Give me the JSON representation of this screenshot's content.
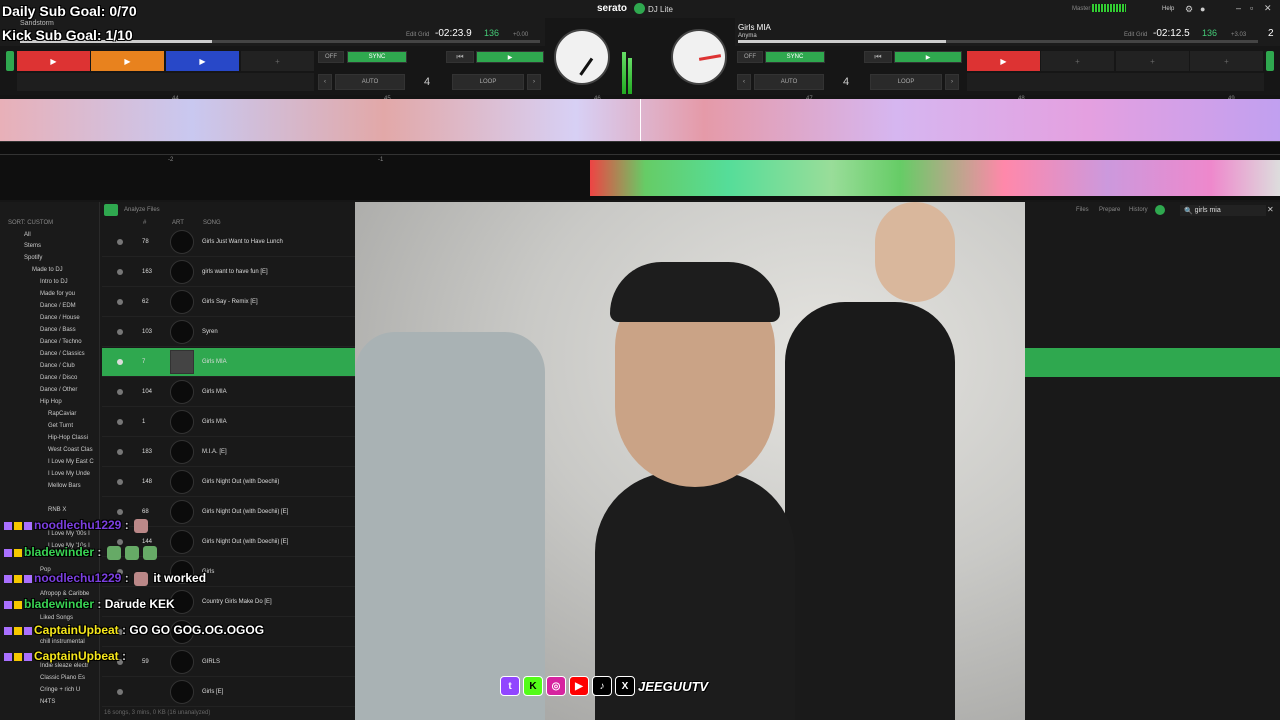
{
  "overlay": {
    "daily_goal": "Daily Sub Goal: 0/70",
    "kick_goal": "Kick Sub Goal: 1/10"
  },
  "app": {
    "title": "serato",
    "subtitle": "DJ Lite"
  },
  "topbar": {
    "master": "Master",
    "help": "Help"
  },
  "deck_left": {
    "track": "Sandstorm",
    "time": "-02:23.9",
    "bpm": "136",
    "bpm_sub": "+0.00",
    "edit_grid": "Edit Grid",
    "loop_count": "4",
    "auto": "AUTO",
    "loop": "LOOP",
    "sync": "SYNC",
    "off": "OFF"
  },
  "deck_right": {
    "track": "Girls MIA",
    "artist": "Anyma",
    "time": "-02:12.5",
    "bpm": "136",
    "bpm_sub": "+3.03",
    "edit_grid": "Edit Grid",
    "loop_count": "4",
    "auto": "AUTO",
    "loop": "LOOP",
    "sync": "SYNC",
    "off": "OFF",
    "deck_number": "2"
  },
  "beat_markers": [
    "44",
    "45",
    "46",
    "47",
    "48",
    "49"
  ],
  "overview_markers": [
    "-2",
    "-1"
  ],
  "library": {
    "sort": "SORT: CUSTOM",
    "analyze": "Analyze Files",
    "col_art": "ART",
    "col_song": "SONG",
    "col_num": "#",
    "tabs": [
      "Files",
      "Prepare",
      "History"
    ],
    "search": "girls mia",
    "sidebar": [
      "All",
      "Stems",
      "Spotify",
      "Made to DJ",
      "Intro to DJ",
      "Made for you",
      "Dance / EDM",
      "Dance / House",
      "Dance / Bass",
      "Dance / Techno",
      "Dance / Classics",
      "Dance / Club",
      "Dance / Disco",
      "Dance / Other",
      "Hip Hop",
      "RapCaviar",
      "Get Turnt",
      "Hip-Hop Classi",
      "West Coast Clas",
      "I Love My East C",
      "I Love My Unde",
      "Mellow Bars",
      "RNB X",
      "I Love My '00s I",
      "I Love My '10s I",
      "Pop",
      "Afropop & Caribbe",
      "Liked Songs",
      "chill instrumental",
      "Indie sleaze electr",
      "Classic Piano Es",
      "Cringe + rich U",
      "N4TS"
    ],
    "rows": [
      {
        "num": "78",
        "song": "Girls Just Want to Have Lunch"
      },
      {
        "num": "163",
        "song": "girls want to have fun [E]"
      },
      {
        "num": "62",
        "song": "Girls Say - Remix [E]"
      },
      {
        "num": "103",
        "song": "Syren"
      },
      {
        "num": "7",
        "song": "Girls MIA"
      },
      {
        "num": "104",
        "song": "Girls MIA"
      },
      {
        "num": "1",
        "song": "Girls MIA"
      },
      {
        "num": "183",
        "song": "M.I.A. [E]"
      },
      {
        "num": "148",
        "song": "Girls Night Out (with Doechii)"
      },
      {
        "num": "68",
        "song": "Girls Night Out (with Doechii) [E]"
      },
      {
        "num": "144",
        "song": "Girls Night Out (with Doechii) [E]"
      },
      {
        "num": "",
        "song": "Girls"
      },
      {
        "num": "",
        "song": "Country Girls Make Do [E]"
      },
      {
        "num": "",
        "song": ""
      },
      {
        "num": "59",
        "song": "GIRLS"
      },
      {
        "num": "",
        "song": "Girls [E]"
      }
    ],
    "footer": "16 songs, 3 mins, 0 KB (16 unanalyzed)"
  },
  "chat": [
    {
      "user": "noodlechu1229",
      "msg": "",
      "color": "#7b3fe0"
    },
    {
      "user": "bladewinder",
      "msg": "",
      "color": "#39d353"
    },
    {
      "user": "noodlechu1229",
      "msg": "it worked",
      "color": "#7b3fe0"
    },
    {
      "user": "bladewinder",
      "msg": "Darude KEK",
      "color": "#39d353"
    },
    {
      "user": "CaptainUpbeat",
      "msg": "GO GO GOG.OG.OGOG",
      "color": "#f5e61b"
    },
    {
      "user": "CaptainUpbeat",
      "msg": "",
      "color": "#f5e61b"
    }
  ],
  "social": {
    "brand": "JEEGUUTV"
  }
}
